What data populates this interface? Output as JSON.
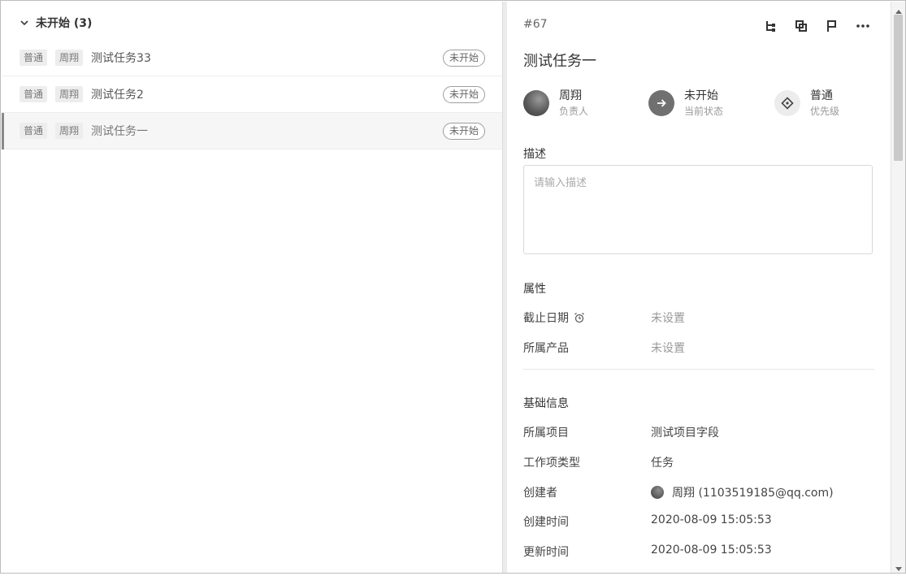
{
  "left_panel": {
    "group": {
      "title": "未开始",
      "count": "(3)"
    },
    "tasks": [
      {
        "priority": "普通",
        "assignee": "周翔",
        "name": "测试任务33",
        "status": "未开始"
      },
      {
        "priority": "普通",
        "assignee": "周翔",
        "name": "测试任务2",
        "status": "未开始"
      },
      {
        "priority": "普通",
        "assignee": "周翔",
        "name": "测试任务一",
        "status": "未开始"
      }
    ]
  },
  "detail": {
    "id": "#67",
    "title": "测试任务一",
    "assignee": {
      "value": "周翔",
      "label": "负责人"
    },
    "status": {
      "value": "未开始",
      "label": "当前状态"
    },
    "priority": {
      "value": "普通",
      "label": "优先级"
    },
    "description": {
      "label": "描述",
      "placeholder": "请输入描述",
      "value": ""
    },
    "properties": {
      "label": "属性",
      "due_date": {
        "label": "截止日期",
        "value": "未设置"
      },
      "product": {
        "label": "所属产品",
        "value": "未设置"
      }
    },
    "basic_info": {
      "label": "基础信息",
      "project": {
        "label": "所属项目",
        "value": "测试项目字段"
      },
      "work_item_type": {
        "label": "工作项类型",
        "value": "任务"
      },
      "creator": {
        "label": "创建者",
        "value": "周翔 (1103519185@qq.com)"
      },
      "created_at": {
        "label": "创建时间",
        "value": "2020-08-09 15:05:53"
      },
      "updated_at": {
        "label": "更新时间",
        "value": "2020-08-09 15:05:53"
      }
    }
  },
  "icons": {
    "toolbar": [
      "subtask-icon",
      "copy-icon",
      "flag-icon",
      "more-icon"
    ],
    "status": "arrow-right-icon",
    "priority": "diamond-icon",
    "due_date": "alarm-clock-icon"
  }
}
